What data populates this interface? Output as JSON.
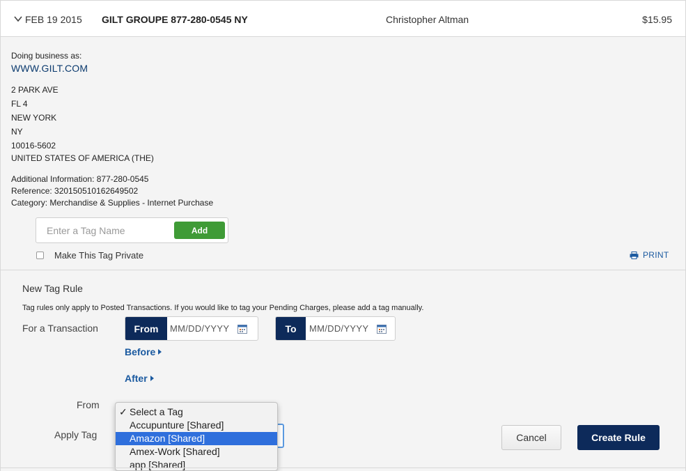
{
  "transaction": {
    "date": "FEB 19 2015",
    "merchant": "GILT GROUPE 877-280-0545 NY",
    "card_member": "Christopher Altman",
    "amount": "$15.95"
  },
  "details": {
    "dba_label": "Doing business as:",
    "dba_value": "WWW.GILT.COM",
    "address": [
      "2 PARK AVE",
      "FL 4",
      "NEW YORK",
      "NY",
      "10016-5602",
      "UNITED STATES OF AMERICA (THE)"
    ],
    "additional_info": "Additional Information: 877-280-0545",
    "reference": "Reference: 320150510162649502",
    "category": "Category: Merchandise & Supplies - Internet Purchase"
  },
  "tagging": {
    "placeholder": "Enter a Tag Name",
    "add_label": "Add",
    "private_label": "Make This Tag Private",
    "print_label": "PRINT"
  },
  "rule": {
    "title": "New Tag Rule",
    "note": "Tag rules only apply to Posted Transactions. If you would like to tag your Pending Charges, please add a tag manually.",
    "for_transaction_label": "For a Transaction",
    "from_tag": "From",
    "from_value": "MM/DD/YYYY",
    "to_tag": "To",
    "to_value": "MM/DD/YYYY",
    "before_label": "Before",
    "after_label": "After",
    "from_label": "From",
    "apply_tag_label": "Apply Tag",
    "options": [
      "Select a Tag",
      "Accupunture [Shared]",
      "Amazon [Shared]",
      "Amex-Work [Shared]",
      "app [Shared]"
    ],
    "checked_option": "Select a Tag",
    "highlighted_option": "Amazon [Shared]",
    "cancel_label": "Cancel",
    "create_label": "Create Rule"
  },
  "colors": {
    "navy": "#0d2a5a",
    "link_blue": "#1b5aa0",
    "add_green": "#3f9b36",
    "highlight_blue": "#2f6fdc"
  }
}
